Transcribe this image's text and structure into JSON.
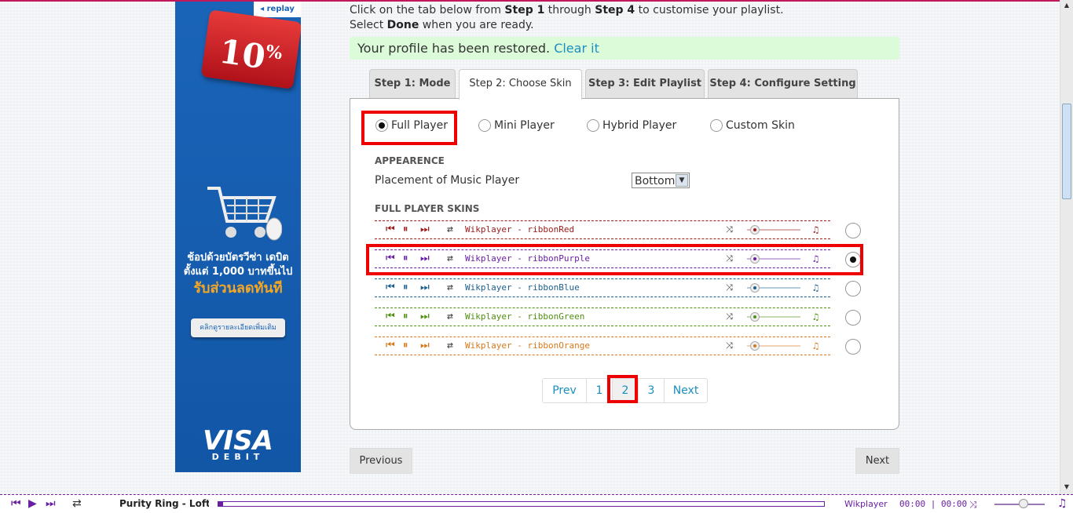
{
  "ad": {
    "replay_label": "◂ replay",
    "discount": "10",
    "discount_unit": "%",
    "thai_line1": "ช้อปด้วยบัตรวีซ่า เดบิต",
    "thai_line2": "ตั้งแต่ 1,000 บาทขึ้นไป",
    "thai_line3": "รับส่วนลดทันที",
    "cta": "คลิกดูรายละเอียดเพิ่มเติม",
    "brand": "VISA",
    "brand_sub": "DEBIT"
  },
  "intro": {
    "line1_a": "Click on the tab below from ",
    "line1_b": "Step 1",
    "line1_c": " through ",
    "line1_d": "Step 4",
    "line1_e": " to customise your playlist.",
    "line2_a": "Select ",
    "line2_b": "Done",
    "line2_c": " when you are ready."
  },
  "notice": {
    "text": "Your profile has been restored.",
    "link": "Clear it"
  },
  "tabs": [
    {
      "label": "Step 1: Mode"
    },
    {
      "label": "Step 2: Choose Skin"
    },
    {
      "label": "Step 3: Edit Playlist"
    },
    {
      "label": "Step 4: Configure Setting"
    }
  ],
  "player_modes": [
    {
      "label": "Full Player",
      "selected": true
    },
    {
      "label": "Mini Player",
      "selected": false
    },
    {
      "label": "Hybrid Player",
      "selected": false
    },
    {
      "label": "Custom Skin",
      "selected": false
    }
  ],
  "appearance": {
    "heading": "APPEARENCE",
    "placement_label": "Placement of Music Player",
    "placement_value": "Bottom"
  },
  "skins": {
    "heading": "FULL PLAYER SKINS",
    "items": [
      {
        "name": "Wikplayer - ribbonRed",
        "color": "#9b1b1b",
        "selected": false
      },
      {
        "name": "Wikplayer - ribbonPurple",
        "color": "#6a1fa3",
        "selected": true
      },
      {
        "name": "Wikplayer - ribbonBlue",
        "color": "#1b5f8f",
        "selected": false
      },
      {
        "name": "Wikplayer - ribbonGreen",
        "color": "#4f8f12",
        "selected": false
      },
      {
        "name": "Wikplayer - ribbonOrange",
        "color": "#d9781a",
        "selected": false
      }
    ]
  },
  "pagination": {
    "prev": "Prev",
    "pages": [
      "1",
      "2",
      "3"
    ],
    "current": "2",
    "next": "Next"
  },
  "nav": {
    "previous": "Previous",
    "next": "Next"
  },
  "player": {
    "title": "Purity Ring - Lofticries",
    "name": "Wikplayer",
    "time": "00:00 | 00:00",
    "color": "#6a1fa3"
  }
}
